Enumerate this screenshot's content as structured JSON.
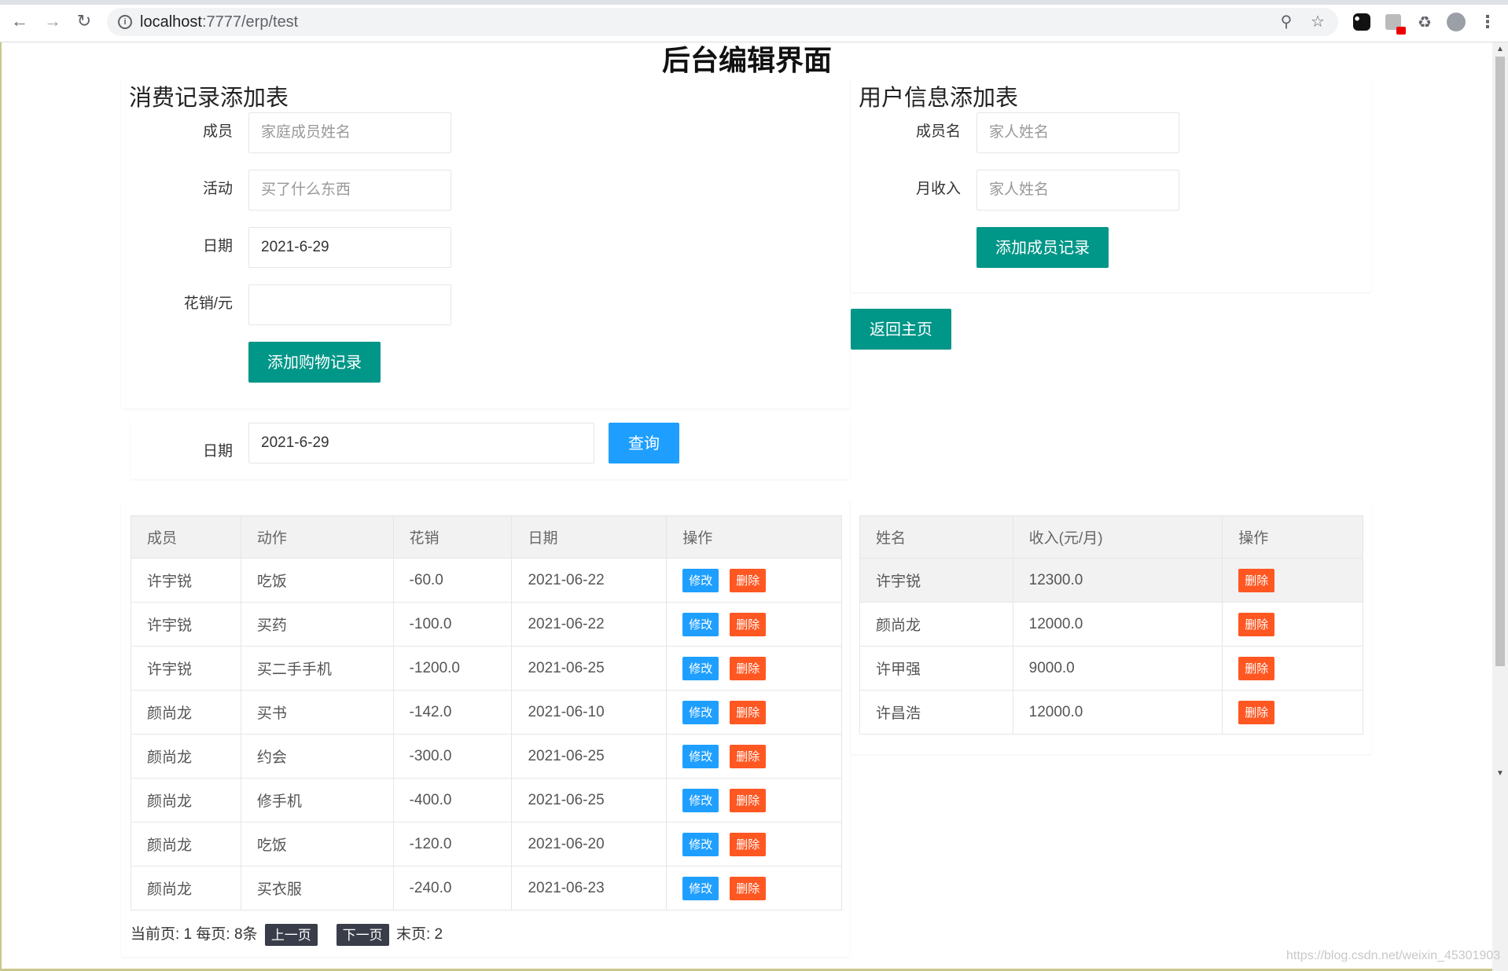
{
  "browser": {
    "url_host": "localhost",
    "url_path": ":7777/erp/test"
  },
  "page": {
    "title": "后台编辑界面"
  },
  "consumption_form": {
    "heading": "消费记录添加表",
    "member_label": "成员",
    "member_placeholder": "家庭成员姓名",
    "activity_label": "活动",
    "activity_placeholder": "买了什么东西",
    "date_label": "日期",
    "date_value": "2021-6-29",
    "cost_label": "花销/元",
    "cost_value": "",
    "submit_label": "添加购物记录"
  },
  "user_form": {
    "heading": "用户信息添加表",
    "name_label": "成员名",
    "name_placeholder": "家人姓名",
    "income_label": "月收入",
    "income_placeholder": "家人姓名",
    "submit_label": "添加成员记录"
  },
  "back_button_label": "返回主页",
  "query": {
    "date_label": "日期",
    "date_value": "2021-6-29",
    "button_label": "查询"
  },
  "records_table": {
    "headers": [
      "成员",
      "动作",
      "花销",
      "日期",
      "操作"
    ],
    "edit_label": "修改",
    "delete_label": "删除",
    "rows": [
      {
        "member": "许宇锐",
        "action": "吃饭",
        "cost": "-60.0",
        "date": "2021-06-22"
      },
      {
        "member": "许宇锐",
        "action": "买药",
        "cost": "-100.0",
        "date": "2021-06-22"
      },
      {
        "member": "许宇锐",
        "action": "买二手手机",
        "cost": "-1200.0",
        "date": "2021-06-25"
      },
      {
        "member": "颜尚龙",
        "action": "买书",
        "cost": "-142.0",
        "date": "2021-06-10"
      },
      {
        "member": "颜尚龙",
        "action": "约会",
        "cost": "-300.0",
        "date": "2021-06-25"
      },
      {
        "member": "颜尚龙",
        "action": "修手机",
        "cost": "-400.0",
        "date": "2021-06-25"
      },
      {
        "member": "颜尚龙",
        "action": "吃饭",
        "cost": "-120.0",
        "date": "2021-06-20"
      },
      {
        "member": "颜尚龙",
        "action": "买衣服",
        "cost": "-240.0",
        "date": "2021-06-23"
      }
    ]
  },
  "users_table": {
    "headers": [
      "姓名",
      "收入(元/月)",
      "操作"
    ],
    "delete_label": "删除",
    "rows": [
      {
        "name": "许宇锐",
        "income": "12300.0"
      },
      {
        "name": "颜尚龙",
        "income": "12000.0"
      },
      {
        "name": "许甲强",
        "income": "9000.0"
      },
      {
        "name": "许昌浩",
        "income": "12000.0"
      }
    ]
  },
  "pager": {
    "current_text": "当前页: 1 每页: 8条",
    "prev_label": "上一页",
    "next_label": "下一页",
    "last_text": "末页: 2"
  },
  "watermark": "https://blog.csdn.net/weixin_45301903",
  "colors": {
    "teal": "#009688",
    "blue": "#1e9fff",
    "orange": "#ff5722",
    "dark": "#393d49"
  }
}
